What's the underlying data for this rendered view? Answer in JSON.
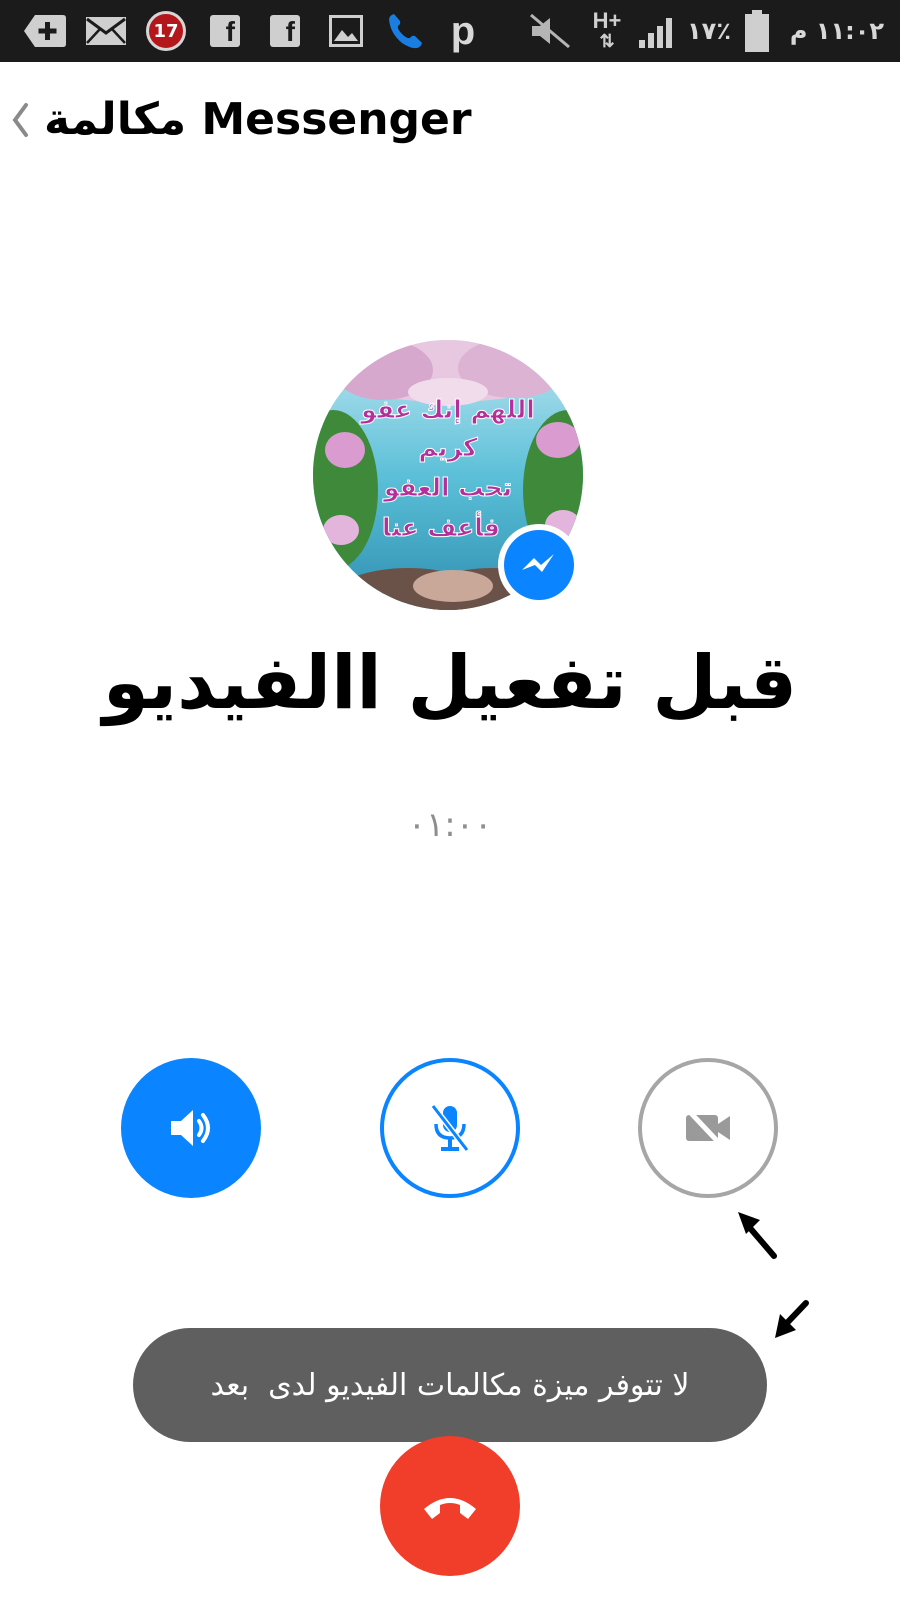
{
  "status_bar": {
    "notification_count": "17",
    "network_type": "H+",
    "battery_percent": "١٧٪",
    "time": "١١:٠٢ م",
    "icons": [
      "add-box-icon",
      "mail-icon",
      "notification-badge-icon",
      "facebook-icon",
      "facebook-icon",
      "gallery-icon",
      "phone-icon",
      "p-app-icon",
      "mute-icon",
      "network-hplus-icon",
      "signal-icon",
      "battery-icon"
    ]
  },
  "header": {
    "title": "مكالمة Messenger",
    "back_icon": "chevron-left-icon"
  },
  "call": {
    "caller_name": "قبل تفعيل االفيديو",
    "timer": "٠١:٠٠",
    "avatar_text_lines": [
      "اللهم إنك عفو",
      "كريم",
      "تحب العفو",
      "فأعف عنا"
    ]
  },
  "controls": {
    "speaker_icon": "speaker-icon",
    "mute_icon": "microphone-off-icon",
    "video_icon": "video-off-icon",
    "end_call_icon": "hang-up-icon"
  },
  "toast": {
    "message": "لا تتوفر ميزة مكالمات الفيديو لدى  بعد"
  },
  "colors": {
    "accent": "#0a84ff",
    "end_call": "#f03e2a",
    "disabled": "#a6a6a6",
    "toast_bg": "#5f5f5f",
    "status_bar_bg": "#1b1b1b"
  }
}
